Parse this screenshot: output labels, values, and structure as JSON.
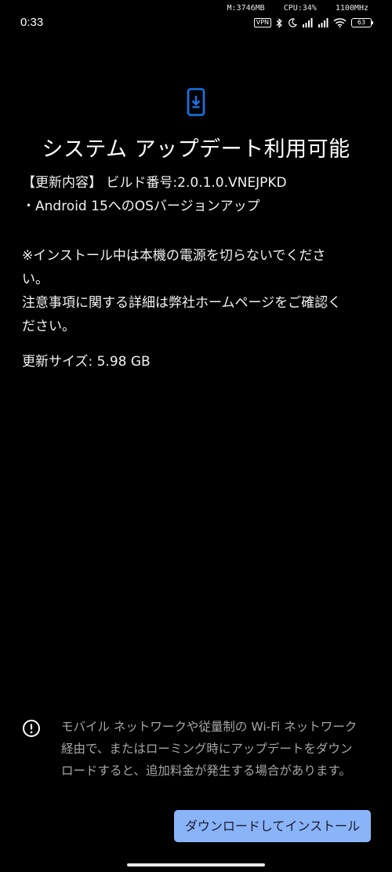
{
  "status_bar": {
    "time": "0:33",
    "memory": "M:3746MB",
    "cpu": "CPU:34%",
    "freq": "1100MHz",
    "vpn": "VPN",
    "battery": "63"
  },
  "update": {
    "title": "システム アップデート利用可能",
    "details_line1": "【更新内容】 ビルド番号:2.0.1.0.VNEJPKD",
    "details_line2": "・Android 15へのOSバージョンアップ",
    "note_line1": "※インストール中は本機の電源を切らないでくださ",
    "note_line2": "い。",
    "note_line3": "注意事項に関する詳細は弊社ホームページをご確認く",
    "note_line4": "ださい。",
    "size": "更新サイズ: 5.98 GB"
  },
  "warning": {
    "line1": "モバイル ネットワークや従量制の Wi-Fi ネットワーク",
    "line2": "経由で、またはローミング時にアップデートをダウン",
    "line3": "ロードすると、追加料金が発生する場合があります。"
  },
  "actions": {
    "install_label": "ダウンロードしてインストール"
  },
  "colors": {
    "accent": "#8ab4f8",
    "icon_blue": "#1a73e8",
    "background": "#000000"
  }
}
